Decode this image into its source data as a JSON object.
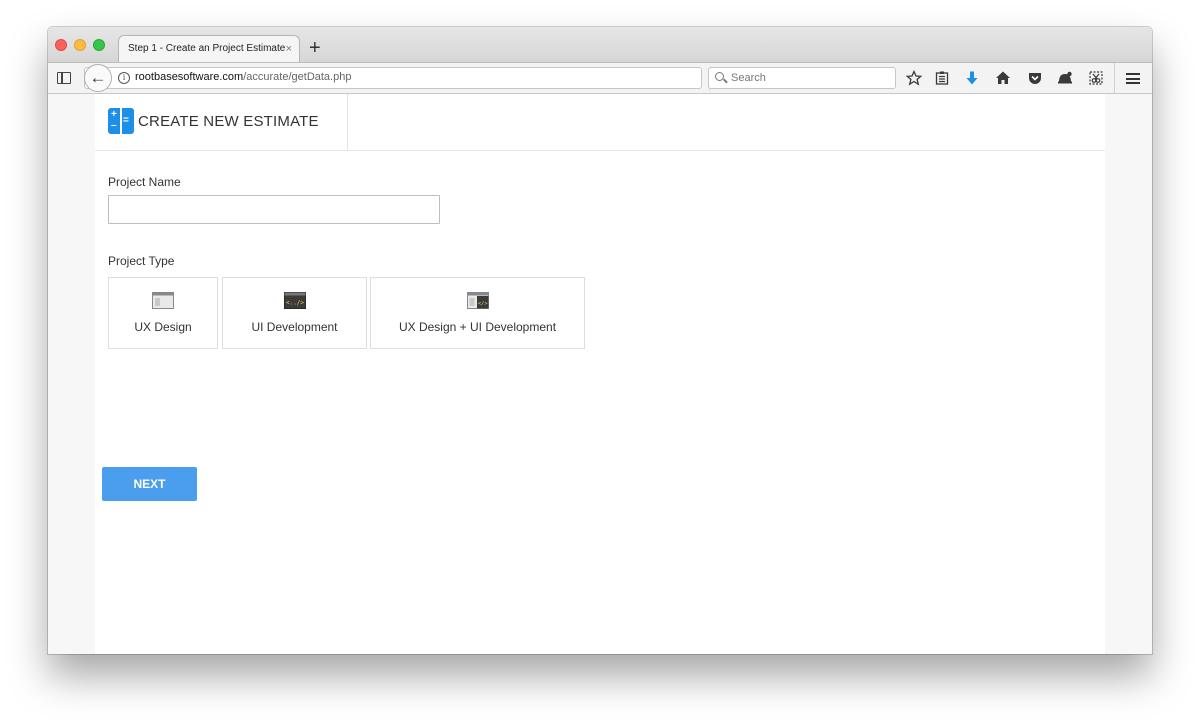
{
  "browser": {
    "tab_title": "Step 1 - Create an Project Estimate",
    "tab_close": "×",
    "new_tab": "+",
    "url_host": "rootbasesoftware.com",
    "url_path": "/accurate/getData.php",
    "search_placeholder": "Search",
    "icons": [
      "sidebar-icon",
      "back-icon",
      "info-icon",
      "reload-icon",
      "search-icon",
      "bookmark-star-icon",
      "reading-list-icon",
      "download-icon",
      "home-icon",
      "pocket-icon",
      "hello-icon",
      "screenshot-icon",
      "menu-icon"
    ]
  },
  "header": {
    "title": "CREATE NEW ESTIMATE",
    "icon": "calculator-icon"
  },
  "form": {
    "project_name_label": "Project Name",
    "project_name_value": "",
    "project_type_label": "Project Type",
    "project_types": [
      {
        "label": "UX Design",
        "icon": "browser-window-icon"
      },
      {
        "label": "UI Development",
        "icon": "code-window-icon"
      },
      {
        "label": "UX Design + UI Development",
        "icon": "design-code-window-icon"
      }
    ],
    "next_label": "NEXT"
  },
  "colors": {
    "accent": "#4a9eed",
    "icon_blue": "#1d8fe8"
  }
}
